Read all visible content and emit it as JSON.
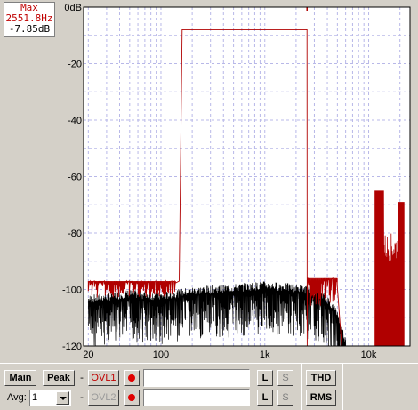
{
  "readout": {
    "title": "Max",
    "frequency": "2551.8Hz",
    "level": "-7.85dB"
  },
  "chart_data": {
    "type": "line",
    "xscale": "log",
    "xlim": [
      18,
      25000
    ],
    "ylim": [
      -120,
      0
    ],
    "y_ticks": [
      "0dB",
      "-20",
      "-40",
      "-60",
      "-80",
      "-100",
      "-120"
    ],
    "x_ticks": [
      "20",
      "100",
      "1k",
      "10k"
    ],
    "grid": true,
    "series": [
      {
        "color": "#b00000",
        "x": [
          20,
          120,
          140,
          150,
          160,
          1000,
          2550,
          2560,
          2600,
          4000,
          5000,
          5500,
          7000,
          7500,
          11500,
          12000,
          13000,
          20000,
          22000
        ],
        "y": [
          -100,
          -101,
          -100,
          -8,
          -8,
          -8,
          -8,
          -100,
          -97,
          -96,
          -110,
          -120,
          -120,
          -120,
          -120,
          -65,
          -68,
          -70,
          -120
        ]
      },
      {
        "color": "#000000",
        "x": [
          20,
          50,
          100,
          200,
          500,
          1000,
          2000,
          3000,
          4000,
          5000,
          6000
        ],
        "y": [
          -105,
          -103,
          -104,
          -102,
          -101,
          -100,
          -101,
          -102,
          -105,
          -110,
          -120
        ]
      }
    ]
  },
  "controls": {
    "main_label": "Main",
    "peak_label": "Peak",
    "dash1": "-",
    "dash2": "-",
    "ovl1_label": "OVL1",
    "ovl2_label": "OVL2",
    "l1": "L",
    "s1": "S",
    "l2": "L",
    "s2": "S",
    "thd_label": "THD",
    "rms_label": "RMS",
    "avg_label": "Avg:",
    "avg_value": "1",
    "field1": "",
    "field2": ""
  }
}
